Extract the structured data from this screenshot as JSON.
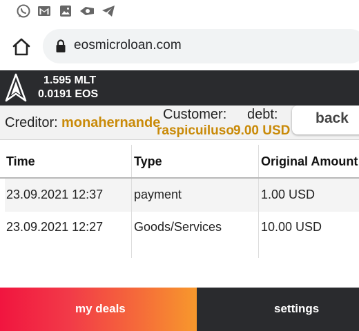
{
  "status_bar": {
    "icons": [
      "whatsapp-icon",
      "gmail-icon",
      "gallery-icon",
      "mail-app-icon",
      "telegram-icon"
    ]
  },
  "browser": {
    "url": "eosmicroloan.com",
    "home_icon": "home-icon",
    "lock_icon": "lock-icon"
  },
  "header": {
    "logo": "app-logo",
    "balance_mlt": "1.595 MLT",
    "balance_eos": "0.0191 EOS"
  },
  "deal": {
    "creditor_label": "Creditor:",
    "creditor_name": "monahernande",
    "customer_label": "Customer:",
    "customer_name": "raspicuiluso",
    "debt_label": "debt:",
    "debt_value": "9.00 USD",
    "back_label": "back"
  },
  "table": {
    "headers": [
      "Time",
      "Type",
      "Original Amount"
    ],
    "rows": [
      [
        "23.09.2021 12:37",
        "payment",
        "1.00 USD"
      ],
      [
        "23.09.2021 12:27",
        "Goods/Services",
        "10.00 USD"
      ]
    ]
  },
  "nav": {
    "deals_label": "my deals",
    "settings_label": "settings"
  },
  "colors": {
    "accent": "#c98a08",
    "dark": "#2a2b2e",
    "nav_gradient_start": "#f1153f",
    "nav_gradient_end": "#f7982c"
  }
}
